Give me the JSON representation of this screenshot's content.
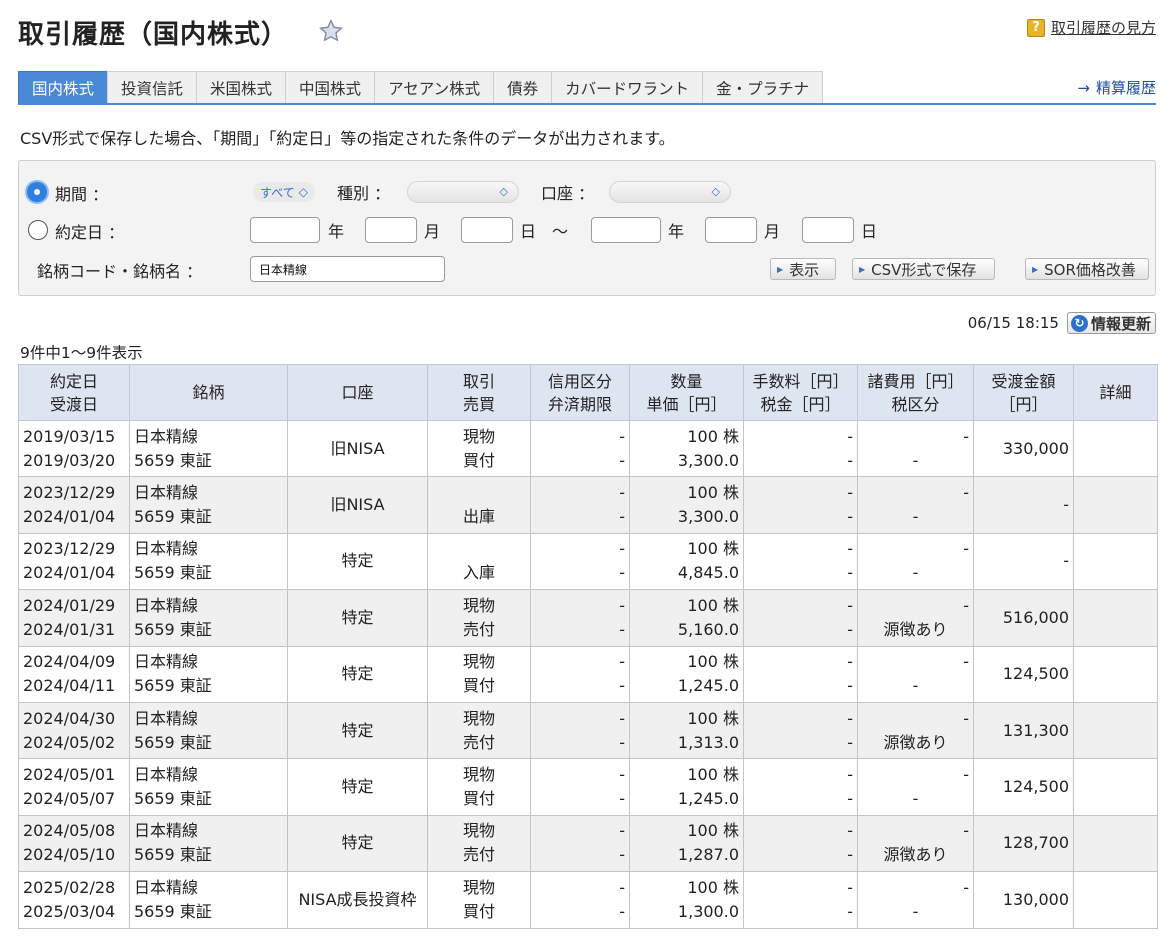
{
  "page": {
    "title": "取引履歴（国内株式）",
    "help_link": "取引履歴の見方",
    "settle_link": "精算履歴",
    "note": "CSV形式で保存した場合、「期間」「約定日」等の指定された条件のデータが出力されます。"
  },
  "tabs": [
    "国内株式",
    "投資信託",
    "米国株式",
    "中国株式",
    "アセアン株式",
    "債券",
    "カバードワラント",
    "金・プラチナ"
  ],
  "filter": {
    "period_label": "期間 ：",
    "period_value": "すべて",
    "type_label": "種別 ：",
    "account_label": "口座 ：",
    "date_label": "約定日 ：",
    "year": "年",
    "month": "月",
    "day": "日",
    "tilde": "〜",
    "stock_label": "銘柄コード・銘柄名 ：",
    "stock_value": "日本精線",
    "btn_show": "表示",
    "btn_csv": "CSV形式で保存",
    "btn_sor": "SOR価格改善"
  },
  "status": {
    "timestamp": "06/15 18:15",
    "refresh_label": "情報更新",
    "count": "9件中1〜9件表示"
  },
  "table": {
    "headers": [
      [
        "約定日",
        "受渡日"
      ],
      [
        "銘柄"
      ],
      [
        "口座"
      ],
      [
        "取引",
        "売買"
      ],
      [
        "信用区分",
        "弁済期限"
      ],
      [
        "数量",
        "単価［円］"
      ],
      [
        "手数料［円］",
        "税金［円］"
      ],
      [
        "諸費用［円］",
        "税区分"
      ],
      [
        "受渡金額",
        "［円］"
      ],
      [
        "詳細"
      ]
    ],
    "rows": [
      {
        "d1": "2019/03/15",
        "d2": "2019/03/20",
        "n1": "日本精線",
        "n2": "5659 東証",
        "acct": "旧NISA",
        "t1": "現物",
        "t2": "買付",
        "c1": "-",
        "c2": "-",
        "q": "100 株",
        "p": "3,300.0",
        "f1": "-",
        "f2": "-",
        "e1": "-",
        "e2": "-",
        "amt": "330,000"
      },
      {
        "d1": "2023/12/29",
        "d2": "2024/01/04",
        "n1": "日本精線",
        "n2": "5659 東証",
        "acct": "旧NISA",
        "t1": "",
        "t2": "出庫",
        "c1": "-",
        "c2": "-",
        "q": "100 株",
        "p": "3,300.0",
        "f1": "-",
        "f2": "-",
        "e1": "-",
        "e2": "-",
        "amt": "-"
      },
      {
        "d1": "2023/12/29",
        "d2": "2024/01/04",
        "n1": "日本精線",
        "n2": "5659 東証",
        "acct": "特定",
        "t1": "",
        "t2": "入庫",
        "c1": "-",
        "c2": "-",
        "q": "100 株",
        "p": "4,845.0",
        "f1": "-",
        "f2": "-",
        "e1": "-",
        "e2": "-",
        "amt": "-"
      },
      {
        "d1": "2024/01/29",
        "d2": "2024/01/31",
        "n1": "日本精線",
        "n2": "5659 東証",
        "acct": "特定",
        "t1": "現物",
        "t2": "売付",
        "c1": "-",
        "c2": "-",
        "q": "100 株",
        "p": "5,160.0",
        "f1": "-",
        "f2": "-",
        "e1": "-",
        "e2": "源徴あり",
        "amt": "516,000"
      },
      {
        "d1": "2024/04/09",
        "d2": "2024/04/11",
        "n1": "日本精線",
        "n2": "5659 東証",
        "acct": "特定",
        "t1": "現物",
        "t2": "買付",
        "c1": "-",
        "c2": "-",
        "q": "100 株",
        "p": "1,245.0",
        "f1": "-",
        "f2": "-",
        "e1": "-",
        "e2": "-",
        "amt": "124,500"
      },
      {
        "d1": "2024/04/30",
        "d2": "2024/05/02",
        "n1": "日本精線",
        "n2": "5659 東証",
        "acct": "特定",
        "t1": "現物",
        "t2": "売付",
        "c1": "-",
        "c2": "-",
        "q": "100 株",
        "p": "1,313.0",
        "f1": "-",
        "f2": "-",
        "e1": "-",
        "e2": "源徴あり",
        "amt": "131,300"
      },
      {
        "d1": "2024/05/01",
        "d2": "2024/05/07",
        "n1": "日本精線",
        "n2": "5659 東証",
        "acct": "特定",
        "t1": "現物",
        "t2": "買付",
        "c1": "-",
        "c2": "-",
        "q": "100 株",
        "p": "1,245.0",
        "f1": "-",
        "f2": "-",
        "e1": "-",
        "e2": "-",
        "amt": "124,500"
      },
      {
        "d1": "2024/05/08",
        "d2": "2024/05/10",
        "n1": "日本精線",
        "n2": "5659 東証",
        "acct": "特定",
        "t1": "現物",
        "t2": "売付",
        "c1": "-",
        "c2": "-",
        "q": "100 株",
        "p": "1,287.0",
        "f1": "-",
        "f2": "-",
        "e1": "-",
        "e2": "源徴あり",
        "amt": "128,700"
      },
      {
        "d1": "2025/02/28",
        "d2": "2025/03/04",
        "n1": "日本精線",
        "n2": "5659 東証",
        "acct": "NISA成長投資枠",
        "t1": "現物",
        "t2": "買付",
        "c1": "-",
        "c2": "-",
        "q": "100 株",
        "p": "1,300.0",
        "f1": "-",
        "f2": "-",
        "e1": "-",
        "e2": "-",
        "amt": "130,000"
      }
    ]
  },
  "colors": {
    "accent": "#4a88d8",
    "header_bg": "#dde6f0",
    "alt_row": "#f0f0f0"
  }
}
